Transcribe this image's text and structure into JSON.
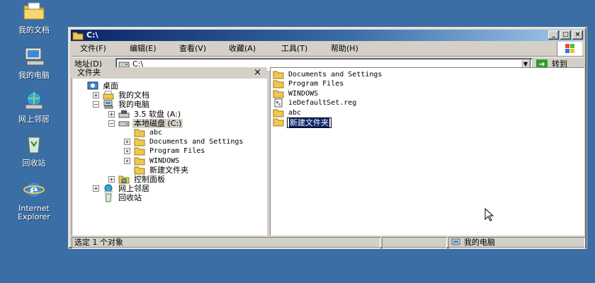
{
  "desktop": {
    "icons": [
      {
        "label": "我的文档",
        "icon": "my-documents-icon"
      },
      {
        "label": "我的电脑",
        "icon": "my-computer-icon"
      },
      {
        "label": "网上邻居",
        "icon": "network-places-icon"
      },
      {
        "label": "回收站",
        "icon": "recycle-bin-icon"
      },
      {
        "label_line1": "Internet",
        "label_line2": "Explorer",
        "icon": "internet-explorer-icon"
      }
    ]
  },
  "window": {
    "title": "C:\\",
    "controls": {
      "minimize": "_",
      "maximize": "□",
      "close": "×"
    },
    "menu": [
      "文件(F)",
      "编辑(E)",
      "查看(V)",
      "收藏(A)",
      "工具(T)",
      "帮助(H)"
    ],
    "address": {
      "label": "地址(D)",
      "value": "C:\\",
      "go_label": "转到"
    },
    "folder_pane": {
      "title": "文件夹",
      "close": "×",
      "tree": [
        {
          "label": "桌面",
          "expander": "",
          "icon": "desktop-icon"
        },
        {
          "label": "我的文档",
          "expander": "+",
          "icon": "my-documents-icon"
        },
        {
          "label": "我的电脑",
          "expander": "−",
          "icon": "my-computer-icon"
        },
        {
          "label": "3.5 软盘 (A:)",
          "expander": "+",
          "icon": "floppy-icon"
        },
        {
          "label": "本地磁盘 (C:)",
          "expander": "−",
          "icon": "hard-disk-icon",
          "selected": true
        },
        {
          "label": "abc",
          "expander": "",
          "icon": "folder-icon"
        },
        {
          "label": "Documents and Settings",
          "expander": "+",
          "icon": "folder-icon"
        },
        {
          "label": "Program Files",
          "expander": "+",
          "icon": "folder-icon"
        },
        {
          "label": "WINDOWS",
          "expander": "+",
          "icon": "folder-icon"
        },
        {
          "label": "新建文件夹",
          "expander": "",
          "icon": "folder-icon"
        },
        {
          "label": "控制面板",
          "expander": "+",
          "icon": "control-panel-icon"
        },
        {
          "label": "网上邻居",
          "expander": "+",
          "icon": "network-places-icon"
        },
        {
          "label": "回收站",
          "expander": "",
          "icon": "recycle-bin-icon"
        }
      ]
    },
    "files": [
      {
        "name": "Documents and Settings",
        "icon": "folder-icon"
      },
      {
        "name": "Program Files",
        "icon": "folder-icon"
      },
      {
        "name": "WINDOWS",
        "icon": "folder-icon"
      },
      {
        "name": "ieDefaultSet.reg",
        "icon": "registry-file-icon"
      },
      {
        "name": "abc",
        "icon": "folder-icon"
      },
      {
        "name": "新建文件夹",
        "icon": "folder-icon",
        "renaming": true
      }
    ],
    "status": {
      "selection": "选定 1 个对象",
      "location": "我的电脑"
    }
  },
  "colors": {
    "desktop": "#3a6ea5",
    "title_start": "#0a246a",
    "title_end": "#a6caf0",
    "folder": "#f0c850",
    "selection": "#0a246a"
  }
}
